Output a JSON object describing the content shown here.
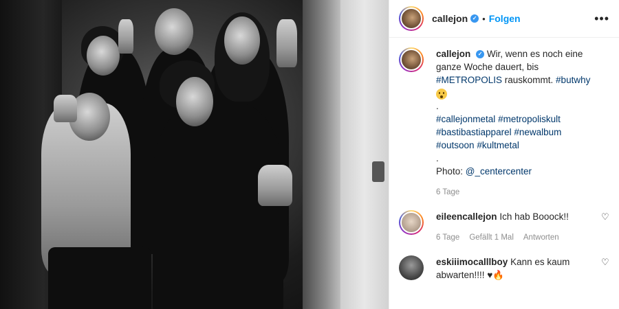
{
  "post": {
    "username": "callejon",
    "follow_label": "Folgen",
    "separator": "•",
    "more_label": "•••",
    "caption": {
      "username": "callejon",
      "line1_pre": "Wir, wenn es noch eine ganze Woche dauert, bis ",
      "tag_metropolis": "#METROPOLIS",
      "line1_mid": " rauskommt. ",
      "tag_butwhy": "#butwhy",
      "dot1": ".",
      "tags_line1a": "#callejonmetal",
      "tags_line1b": "#metropoliskult",
      "tags_line2a": "#bastibastiapparel",
      "tags_line2b": "#newalbum",
      "tags_line3a": "#outsoon",
      "tags_line3b": "#kultmetal",
      "dot2": ".",
      "photo_prefix": "Photo: ",
      "photo_credit": "@_centercenter",
      "time": "6 Tage"
    },
    "comments": [
      {
        "username": "eileencallejon",
        "text": "Ich hab Booock!!",
        "time": "6 Tage",
        "likes": "Gefällt 1 Mal",
        "reply": "Antworten"
      },
      {
        "username": "eskiiimocalllboy",
        "text": "Kann es kaum abwarten!!!! ",
        "heart_glyph": "♥",
        "fire_glyph": "🔥"
      }
    ],
    "icons": {
      "verified": "✓",
      "like": "♡"
    }
  }
}
